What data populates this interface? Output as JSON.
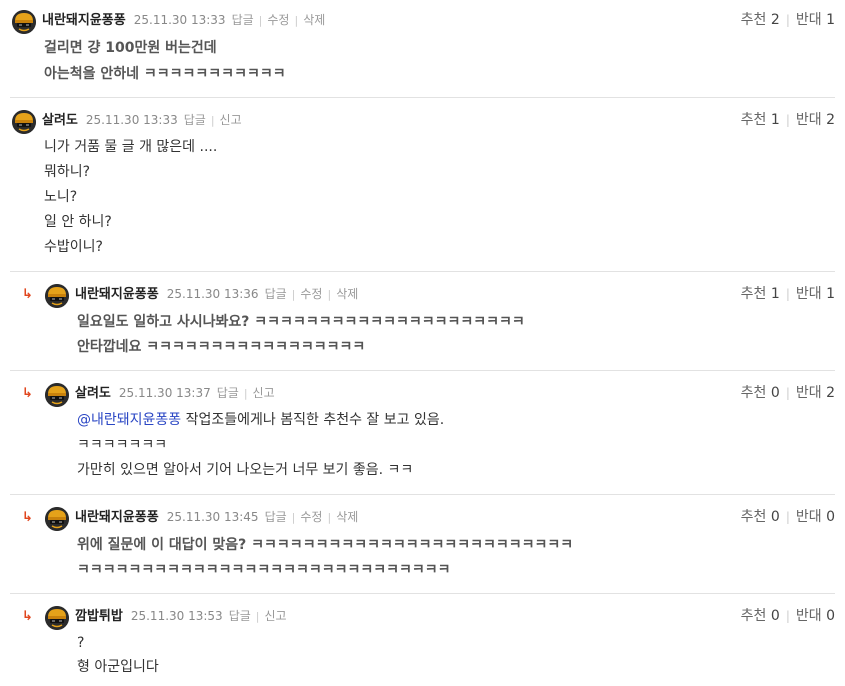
{
  "labels": {
    "reply": "답글",
    "edit": "수정",
    "delete": "삭제",
    "report": "신고",
    "up": "추천",
    "down": "반대"
  },
  "comments": [
    {
      "nick": "내란돼지윤퐁퐁",
      "date": "25.11.30 13:33",
      "up": "2",
      "down": "1",
      "lines": [
        "걸리면 걍 100만원 버는건데",
        "아는척을 안하네 ㅋㅋㅋㅋㅋㅋㅋㅋㅋㅋㅋ"
      ]
    },
    {
      "nick": "살려도",
      "date": "25.11.30 13:33",
      "up": "1",
      "down": "2",
      "lines": [
        "니가 거품 물 글 개 많은데 ....",
        "뭐하니?",
        "노니?",
        "일 안 하니?",
        "수밥이니?"
      ]
    },
    {
      "nick": "내란돼지윤퐁퐁",
      "date": "25.11.30 13:36",
      "up": "1",
      "down": "1",
      "lines": [
        "일요일도 일하고 사시나봐요? ㅋㅋㅋㅋㅋㅋㅋㅋㅋㅋㅋㅋㅋㅋㅋㅋㅋㅋㅋㅋㅋ",
        "안타깝네요 ㅋㅋㅋㅋㅋㅋㅋㅋㅋㅋㅋㅋㅋㅋㅋㅋㅋ"
      ]
    },
    {
      "nick": "살려도",
      "date": "25.11.30 13:37",
      "up": "0",
      "down": "2",
      "mention": "@내란돼지윤퐁퐁",
      "lines": [
        "작업조들에게나 봄직한 추천수 잘 보고 있음.",
        "ㅋㅋㅋㅋㅋㅋㅋ",
        "가만히 있으면 알아서 기어 나오는거 너무 보기 좋음. ㅋㅋ"
      ]
    },
    {
      "nick": "내란돼지윤퐁퐁",
      "date": "25.11.30 13:45",
      "up": "0",
      "down": "0",
      "lines": [
        "위에 질문에 이 대답이 맞음? ㅋㅋㅋㅋㅋㅋㅋㅋㅋㅋㅋㅋㅋㅋㅋㅋㅋㅋㅋㅋㅋㅋㅋㅋㅋ",
        "ㅋㅋㅋㅋㅋㅋㅋㅋㅋㅋㅋㅋㅋㅋㅋㅋㅋㅋㅋㅋㅋㅋㅋㅋㅋㅋㅋㅋㅋ"
      ]
    },
    {
      "nick": "깜밥튀밥",
      "date": "25.11.30 13:53",
      "up": "0",
      "down": "0",
      "lines": [
        "?",
        "형 아군입니다"
      ]
    }
  ],
  "colors": {
    "reply_arrow": "#e0461e",
    "mention": "#2a46c4",
    "divider": "#e2e2e2"
  },
  "icons": {
    "avatar": "helmet-avatar-icon",
    "reply": "reply-arrow-icon"
  }
}
